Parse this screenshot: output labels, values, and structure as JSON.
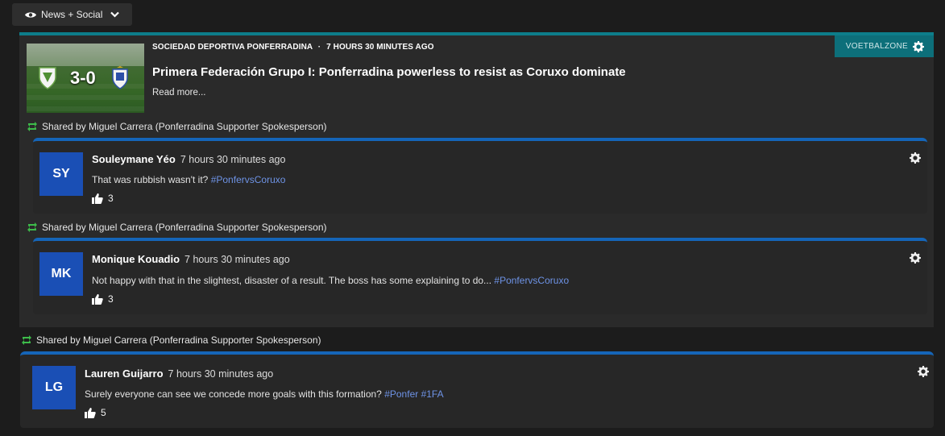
{
  "filter": {
    "label": "News + Social"
  },
  "news": {
    "source": "SOCIEDAD DEPORTIVA PONFERRADINA",
    "separator": "·",
    "time": "7 HOURS 30 MINUTES AGO",
    "title": "Primera Federación Grupo I: Ponferradina powerless to resist as Coruxo dominate",
    "read_more": "Read more...",
    "tag": "VOETBALZONE",
    "image": {
      "score": "3-0"
    }
  },
  "shared_by": "Shared by Miguel Carrera (Ponferradina Supporter Spokesperson)",
  "posts": [
    {
      "initials": "SY",
      "name": "Souleymane Yéo",
      "time": "7 hours 30 minutes ago",
      "text": "That was rubbish wasn't it?",
      "hashtags": "#PonfervsCoruxo",
      "likes": "3"
    },
    {
      "initials": "MK",
      "name": "Monique Kouadio",
      "time": "7 hours 30 minutes ago",
      "text": "Not happy with that in the slightest, disaster of a result. The boss has some explaining to do...",
      "hashtags": "#PonfervsCoruxo",
      "likes": "3"
    },
    {
      "initials": "LG",
      "name": "Lauren Guijarro",
      "time": "7 hours 30 minutes ago",
      "text": "Surely everyone can see we concede more goals with this formation?",
      "hashtags": "#Ponfer #1FA",
      "likes": "5"
    }
  ],
  "colors": {
    "accent_teal": "#0d7d8a",
    "post_blue": "#1565b8",
    "avatar_blue": "#1a4fb5",
    "hashtag": "#6e93e6",
    "retweet_green": "#3dbb4a"
  },
  "icons": {
    "filter": "eye-icon",
    "dropdown": "chevron-down-icon",
    "tag": "gear-icon",
    "shared": "retweet-icon",
    "likes": "thumbs-up-icon",
    "post_menu": "gear-icon"
  }
}
